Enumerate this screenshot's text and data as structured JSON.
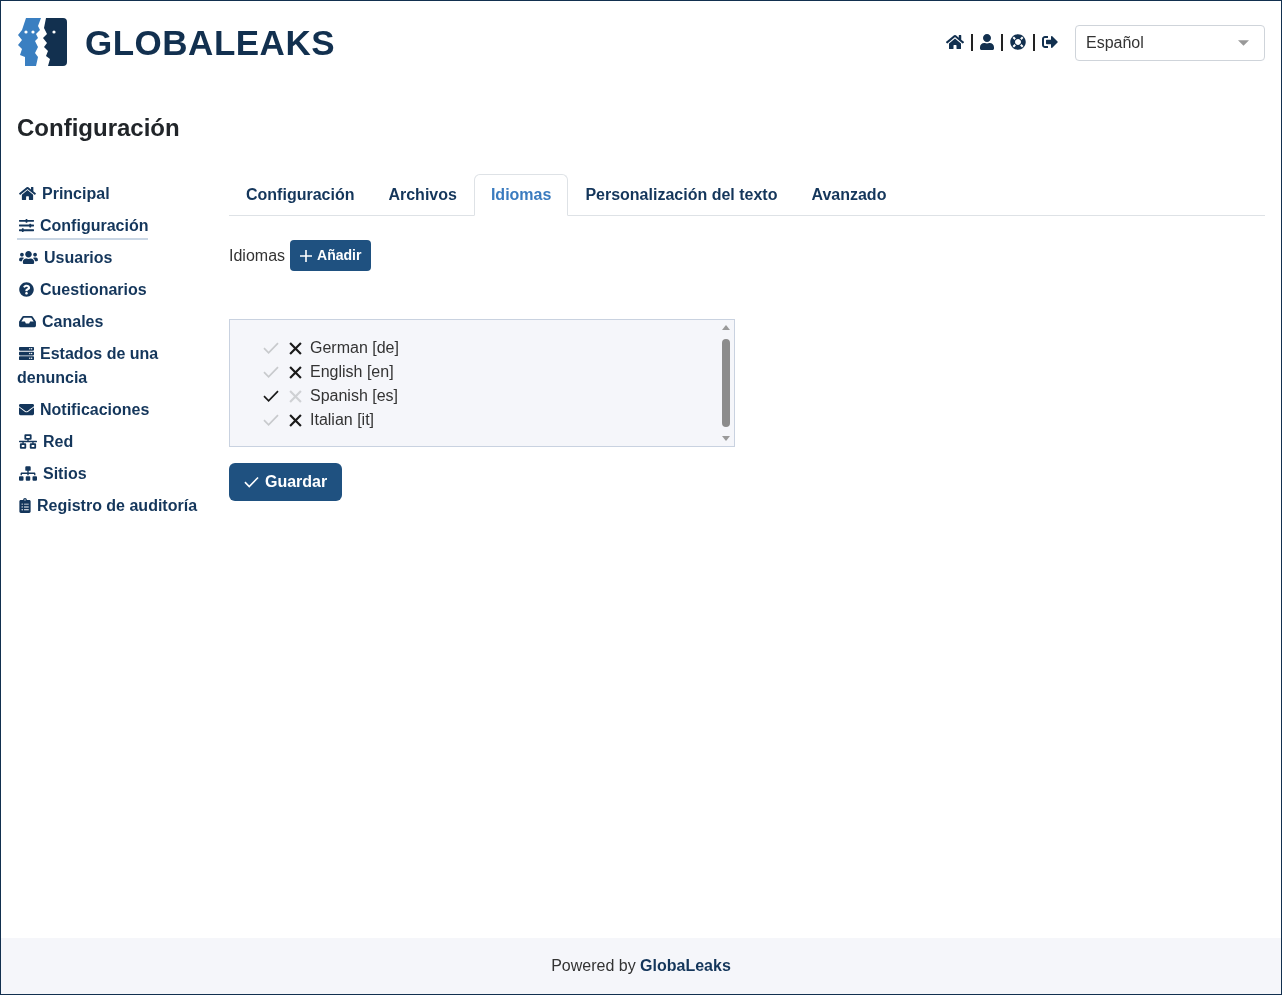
{
  "header": {
    "logo_text": "GLOBALEAKS",
    "language": "Español"
  },
  "page_title": "Configuración",
  "sidebar": {
    "items": [
      {
        "label": "Principal",
        "selected": false
      },
      {
        "label": "Configuración",
        "selected": true
      },
      {
        "label": "Usuarios",
        "selected": false
      },
      {
        "label": "Cuestionarios",
        "selected": false
      },
      {
        "label": "Canales",
        "selected": false
      },
      {
        "label": "Estados de una denuncia",
        "selected": false
      },
      {
        "label": "Notificaciones",
        "selected": false
      },
      {
        "label": "Red",
        "selected": false
      },
      {
        "label": "Sitios",
        "selected": false
      },
      {
        "label": "Registro de auditoría",
        "selected": false
      }
    ]
  },
  "tabs": [
    {
      "label": "Configuración",
      "selected": false
    },
    {
      "label": "Archivos",
      "selected": false
    },
    {
      "label": "Idiomas",
      "selected": true
    },
    {
      "label": "Personalización del texto",
      "selected": false
    },
    {
      "label": "Avanzado",
      "selected": false
    }
  ],
  "languages": {
    "label": "Idiomas",
    "add_button": "Añadir",
    "items": [
      {
        "name": "German [de]",
        "default": false,
        "removable": true
      },
      {
        "name": "English [en]",
        "default": false,
        "removable": true
      },
      {
        "name": "Spanish [es]",
        "default": true,
        "removable": false
      },
      {
        "name": "Italian [it]",
        "default": false,
        "removable": true
      }
    ]
  },
  "save_button": "Guardar",
  "footer": {
    "text": "Powered by **GlobaLeaks**"
  }
}
